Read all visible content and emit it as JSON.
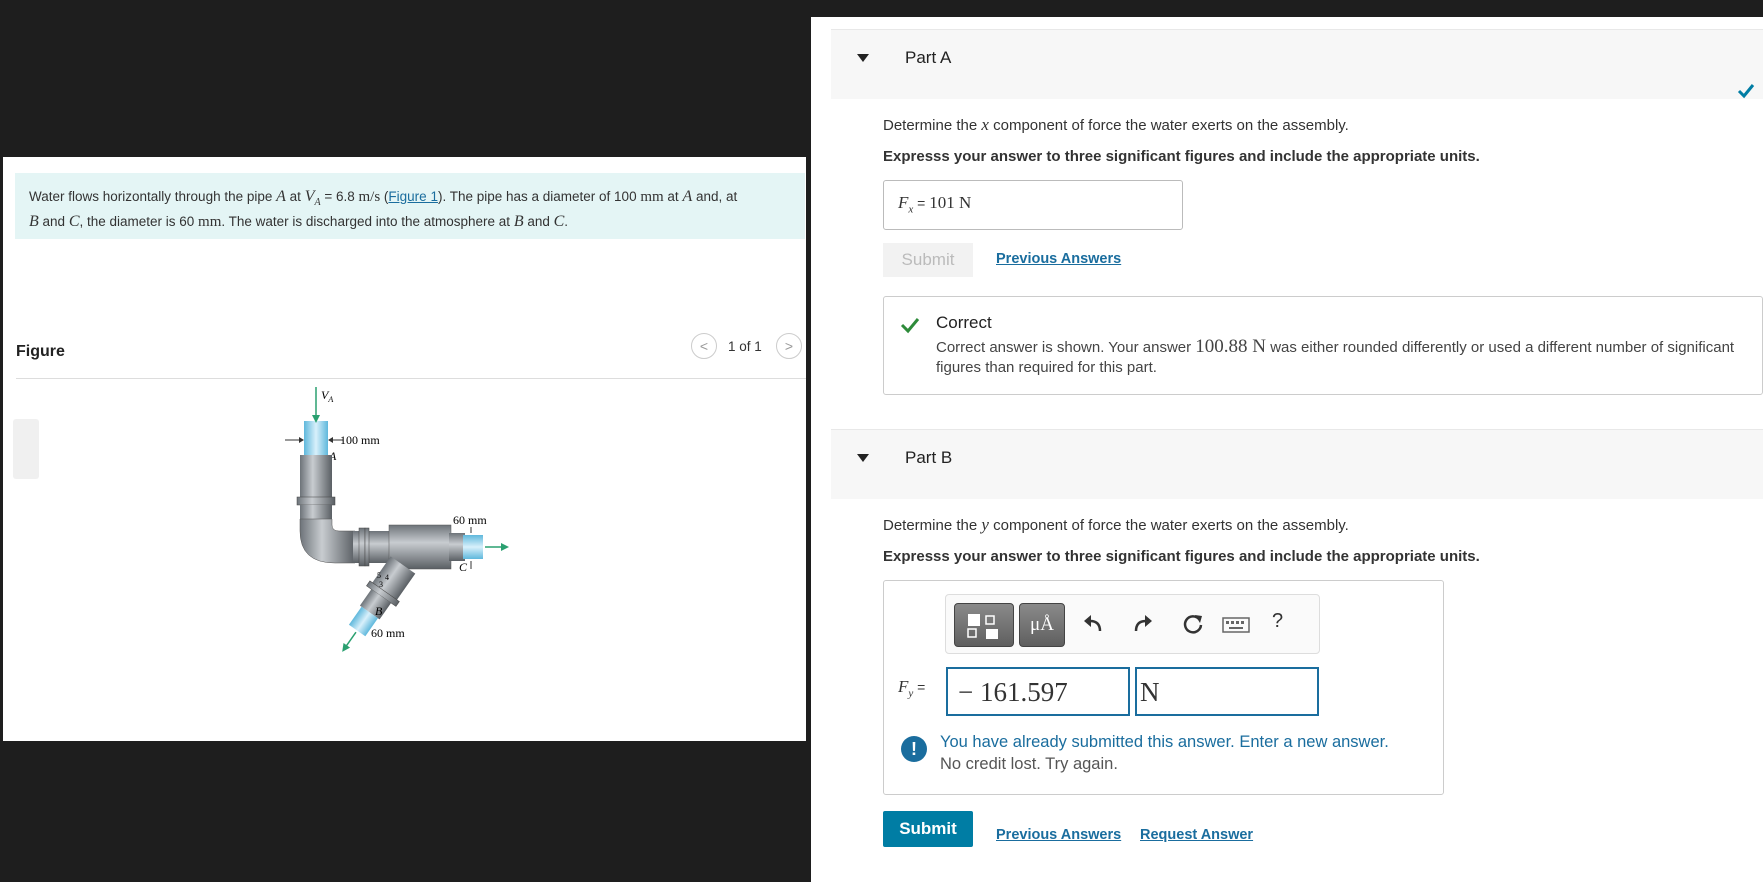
{
  "problem": {
    "text_1": "Water flows horizontally through the pipe ",
    "sym_A": "A",
    "text_2": " at ",
    "sym_VA": "V",
    "sym_VA_sub": "A",
    "text_3": " = 6.8 ",
    "unit_ms": "m/s",
    "text_4": " (",
    "figure_link": "Figure 1",
    "text_5": "). The pipe has a diameter of 100 ",
    "unit_mm1": "mm",
    "text_6": " at ",
    "sym_A2": "A",
    "text_7": " and, at",
    "sym_B": "B",
    "text_8": " and ",
    "sym_C": "C",
    "text_9": ", the diameter is 60 ",
    "unit_mm2": "mm",
    "text_10": ". The water is discharged into the atmosphere at ",
    "sym_B2": "B",
    "text_11": " and ",
    "sym_C2": "C",
    "text_12": "."
  },
  "figure": {
    "title": "Figure",
    "counter": "1 of 1",
    "prev_glyph": "<",
    "next_glyph": ">",
    "labels": {
      "va": "V",
      "va_sub": "A",
      "d100": "100 mm",
      "pA": "A",
      "d60c": "60 mm",
      "pC": "C",
      "pB": "B",
      "d60b": "60 mm",
      "s5": "5",
      "s4": "4",
      "s3": "3"
    }
  },
  "partA": {
    "title": "Part A",
    "instr_1": "Determine the ",
    "instr_var": "x",
    "instr_2": " component of force the water exerts on the assembly.",
    "instr_bold": "Expresss your answer to three significant figures and include the appropriate units.",
    "answer_label": "F",
    "answer_sub": "x",
    "answer_eq": " = ",
    "answer_value": "101 N",
    "submit_label": "Submit",
    "prev_answers": "Previous Answers",
    "feedback_title": "Correct",
    "feedback_1": "Correct answer is shown. Your answer ",
    "feedback_val": "100.88 N",
    "feedback_2": " was either rounded differently or used a different number of significant figures than required for this part."
  },
  "partB": {
    "title": "Part B",
    "instr_1": "Determine the ",
    "instr_var": "y",
    "instr_2": " component of force the water exerts on the assembly.",
    "instr_bold": "Expresss your answer to three significant figures and include the appropriate units.",
    "toolbar": {
      "units_label": "μÅ",
      "help_label": "?"
    },
    "answer_label": "F",
    "answer_sub": "y",
    "answer_eq": " =",
    "value": "− 161.597",
    "unit": "N",
    "warning": "You have already submitted this answer. Enter a new answer.",
    "warning_sub": "No credit lost. Try again.",
    "submit_label": "Submit",
    "prev_answers": "Previous Answers",
    "request_answer": "Request Answer"
  },
  "colors": {
    "accent": "#007da4",
    "link": "#1a6d9e",
    "correct": "#2e8b3a",
    "problem_bg": "#e4f5f5"
  }
}
